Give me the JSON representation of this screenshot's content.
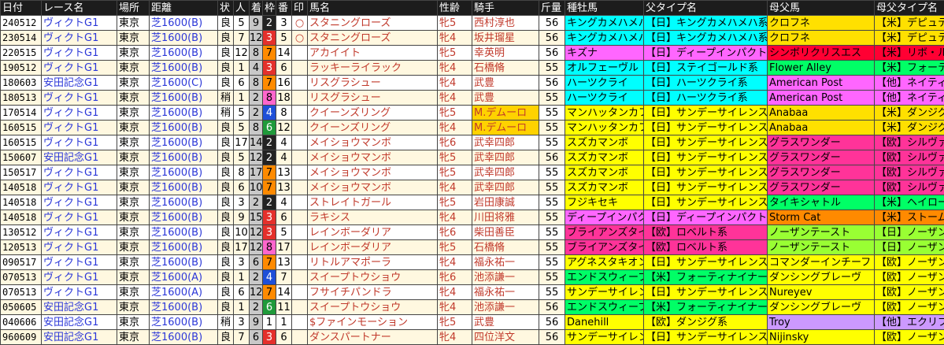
{
  "headers": [
    "日付",
    "レース名",
    "場所",
    "距離",
    "状",
    "人",
    "着",
    "枠",
    "番",
    "印",
    "馬名",
    "性齢",
    "騎手",
    "斤量",
    "種牡馬",
    "父タイプ名",
    "母父馬",
    "母父タイプ名"
  ],
  "colors": {
    "gate": {
      "1": "#ffffff",
      "2": "#222222",
      "3": "#e4302b",
      "4": "#1e4fd8",
      "5": "#f2e600",
      "6": "#1f9a3a",
      "7": "#ff8a00",
      "8": "#ff66cc"
    },
    "row_alt": "#fff8e0",
    "jockey_highlight": "#ffd200"
  },
  "rows": [
    {
      "date": "240512",
      "race": "ヴィクトG1",
      "place": "東京",
      "dist": "芝1600(B)",
      "cond": "良",
      "pop": "5",
      "pos": "9",
      "gate": "2",
      "num": "3",
      "mark": "○",
      "horse": "スタニングローズ",
      "sex": "牝5",
      "jockey": "西村淳也",
      "wt": "56",
      "sire": "キングカメハメハ",
      "sire_bg": "#00ffff",
      "stype": "【日】キングカメハメハ系",
      "stype_bg": "#00ffff",
      "dams": "クロフネ",
      "dams_bg": "#ffe000",
      "dtype": "【米】デピュティミニスター",
      "dtype_bg": "#ffe000"
    },
    {
      "date": "230514",
      "race": "ヴィクトG1",
      "place": "東京",
      "dist": "芝1600(B)",
      "cond": "良",
      "pop": "7",
      "pos": "12",
      "gate": "3",
      "num": "5",
      "mark": "○",
      "horse": "スタニングローズ",
      "sex": "牝4",
      "jockey": "坂井瑠星",
      "wt": "56",
      "sire": "キングカメハメハ",
      "sire_bg": "#00ffff",
      "stype": "【日】キングカメハメハ系",
      "stype_bg": "#00ffff",
      "dams": "クロフネ",
      "dams_bg": "#ffe000",
      "dtype": "【米】デピュティミニスター",
      "dtype_bg": "#ffe000"
    },
    {
      "date": "220515",
      "race": "ヴィクトG1",
      "place": "東京",
      "dist": "芝1600(B)",
      "cond": "良",
      "pop": "12",
      "pos": "8",
      "gate": "7",
      "num": "14",
      "mark": "",
      "horse": "アカイイト",
      "sex": "牝5",
      "jockey": "幸英明",
      "wt": "56",
      "sire": "キズナ",
      "sire_bg": "#ff66ff",
      "stype": "【日】ディープインパクト系",
      "stype_bg": "#ff66ff",
      "dams": "シンボリクリスエス",
      "dams_bg": "#ff0033",
      "dtype": "【米】リボ・ルクリスエス系",
      "dtype_bg": "#ff0033"
    },
    {
      "date": "190512",
      "race": "ヴィクトG1",
      "place": "東京",
      "dist": "芝1600(B)",
      "cond": "良",
      "pop": "1",
      "pos": "4",
      "gate": "3",
      "num": "6",
      "mark": "",
      "horse": "ラッキーライラック",
      "sex": "牝4",
      "jockey": "石橋脩",
      "wt": "55",
      "sire": "オルフェーヴル",
      "sire_bg": "#00ffff",
      "stype": "【日】ステイゴールド系",
      "stype_bg": "#00ffff",
      "dams": "Flower Alley",
      "dams_bg": "#00ff66",
      "dtype": "【米】フォーティナイナー系",
      "dtype_bg": "#00ff66"
    },
    {
      "date": "180603",
      "race": "安田記念G1",
      "place": "東京",
      "dist": "芝1600(C)",
      "cond": "良",
      "pop": "6",
      "pos": "8",
      "gate": "7",
      "num": "16",
      "mark": "",
      "horse": "リスグラシュー",
      "sex": "牝4",
      "jockey": "武豊",
      "wt": "56",
      "sire": "ハーツクライ",
      "sire_bg": "#00ffff",
      "stype": "【日】ハーツクライ系",
      "stype_bg": "#00ffff",
      "dams": "American Post",
      "dams_bg": "#ff66ff",
      "dtype": "【他】ネイティヴダンサー系",
      "dtype_bg": "#ff66ff"
    },
    {
      "date": "180513",
      "race": "ヴィクトG1",
      "place": "東京",
      "dist": "芝1600(B)",
      "cond": "稍",
      "pop": "1",
      "pos": "2",
      "gate": "8",
      "num": "18",
      "mark": "",
      "horse": "リスグラシュー",
      "sex": "牝4",
      "jockey": "武豊",
      "wt": "55",
      "sire": "ハーツクライ",
      "sire_bg": "#00ffff",
      "stype": "【日】ハーツクライ系",
      "stype_bg": "#00ffff",
      "dams": "American Post",
      "dams_bg": "#ff66ff",
      "dtype": "【他】ネイティヴダンサー系",
      "dtype_bg": "#ff66ff"
    },
    {
      "date": "170514",
      "race": "ヴィクトG1",
      "place": "東京",
      "dist": "芝1600(B)",
      "cond": "稍",
      "pop": "5",
      "pos": "2",
      "gate": "4",
      "num": "8",
      "mark": "",
      "horse": "クイーンズリング",
      "sex": "牝5",
      "jockey": "M.デムーロ",
      "wt": "55",
      "sire": "マンハッタンカフェ",
      "sire_bg": "#ffff00",
      "stype": "【日】サンデーサイレンス系",
      "stype_bg": "#ffff00",
      "dams": "Anabaa",
      "dams_bg": "#ffe000",
      "dtype": "【米】ダンジグ系",
      "dtype_bg": "#ffe000"
    },
    {
      "date": "160515",
      "race": "ヴィクトG1",
      "place": "東京",
      "dist": "芝1600(B)",
      "cond": "良",
      "pop": "5",
      "pos": "8",
      "gate": "6",
      "num": "12",
      "mark": "",
      "horse": "クイーンズリング",
      "sex": "牝4",
      "jockey": "M.デムーロ",
      "wt": "55",
      "sire": "マンハッタンカフェ",
      "sire_bg": "#ffff00",
      "stype": "【日】サンデーサイレンス系",
      "stype_bg": "#ffff00",
      "dams": "Anabaa",
      "dams_bg": "#ffe000",
      "dtype": "【米】ダンジグ系",
      "dtype_bg": "#ffe000"
    },
    {
      "date": "160515",
      "race": "ヴィクトG1",
      "place": "東京",
      "dist": "芝1600(B)",
      "cond": "良",
      "pop": "17",
      "pos": "14",
      "gate": "2",
      "num": "4",
      "mark": "",
      "horse": "メイショウマンボ",
      "sex": "牝6",
      "jockey": "武幸四郎",
      "wt": "55",
      "sire": "スズカマンボ",
      "sire_bg": "#ffff00",
      "stype": "【日】サンデーサイレンス系",
      "stype_bg": "#ffff00",
      "dams": "グラスワンダー",
      "dams_bg": "#ff3399",
      "dtype": "【欧】シルヴァーホークロ",
      "dtype_bg": "#ff3399"
    },
    {
      "date": "150607",
      "race": "安田記念G1",
      "place": "東京",
      "dist": "芝1600(B)",
      "cond": "良",
      "pop": "5",
      "pos": "12",
      "gate": "2",
      "num": "4",
      "mark": "",
      "horse": "メイショウマンボ",
      "sex": "牝5",
      "jockey": "武幸四郎",
      "wt": "56",
      "sire": "スズカマンボ",
      "sire_bg": "#ffff00",
      "stype": "【日】サンデーサイレンス系",
      "stype_bg": "#ffff00",
      "dams": "グラスワンダー",
      "dams_bg": "#ff3399",
      "dtype": "【欧】シルヴァーホークロ",
      "dtype_bg": "#ff3399"
    },
    {
      "date": "150517",
      "race": "ヴィクトG1",
      "place": "東京",
      "dist": "芝1600(B)",
      "cond": "良",
      "pop": "8",
      "pos": "17",
      "gate": "7",
      "num": "13",
      "mark": "",
      "horse": "メイショウマンボ",
      "sex": "牝5",
      "jockey": "武幸四郎",
      "wt": "55",
      "sire": "スズカマンボ",
      "sire_bg": "#ffff00",
      "stype": "【日】サンデーサイレンス系",
      "stype_bg": "#ffff00",
      "dams": "グラスワンダー",
      "dams_bg": "#ff3399",
      "dtype": "【欧】シルヴァーホークロ",
      "dtype_bg": "#ff3399"
    },
    {
      "date": "140518",
      "race": "ヴィクトG1",
      "place": "東京",
      "dist": "芝1600(B)",
      "cond": "良",
      "pop": "6",
      "pos": "10",
      "gate": "7",
      "num": "13",
      "mark": "",
      "horse": "メイショウマンボ",
      "sex": "牝4",
      "jockey": "武幸四郎",
      "wt": "55",
      "sire": "スズカマンボ",
      "sire_bg": "#ffff00",
      "stype": "【日】サンデーサイレンス系",
      "stype_bg": "#ffff00",
      "dams": "グラスワンダー",
      "dams_bg": "#ff3399",
      "dtype": "【欧】シルヴァーホークロ",
      "dtype_bg": "#ff3399"
    },
    {
      "date": "140518",
      "race": "ヴィクトG1",
      "place": "東京",
      "dist": "芝1600(B)",
      "cond": "良",
      "pop": "3",
      "pos": "2",
      "gate": "2",
      "num": "4",
      "mark": "",
      "horse": "ストレイトガール",
      "sex": "牝5",
      "jockey": "岩田康誠",
      "wt": "55",
      "sire": "フジキセキ",
      "sire_bg": "#ffff00",
      "stype": "【日】サンデーサイレンス系",
      "stype_bg": "#ffff00",
      "dams": "タイキシャトル",
      "dams_bg": "#00ff66",
      "dtype": "【米】ヘイロー系",
      "dtype_bg": "#00ff66"
    },
    {
      "date": "140518",
      "race": "ヴィクトG1",
      "place": "東京",
      "dist": "芝1600(B)",
      "cond": "良",
      "pop": "9",
      "pos": "15",
      "gate": "3",
      "num": "6",
      "mark": "",
      "horse": "ラキシス",
      "sex": "牝4",
      "jockey": "川田将雅",
      "wt": "55",
      "sire": "ディープインパクト",
      "sire_bg": "#ff66ff",
      "stype": "【日】ディープインパクト系",
      "stype_bg": "#ff66ff",
      "dams": "Storm Cat",
      "dams_bg": "#ff8a00",
      "dtype": "【米】ストームキャット系",
      "dtype_bg": "#ff8a00"
    },
    {
      "date": "130512",
      "race": "ヴィクトG1",
      "place": "東京",
      "dist": "芝1600(B)",
      "cond": "良",
      "pop": "10",
      "pos": "12",
      "gate": "3",
      "num": "5",
      "mark": "",
      "horse": "レインボーダリア",
      "sex": "牝6",
      "jockey": "柴田善臣",
      "wt": "55",
      "sire": "ブライアンズタイム",
      "sire_bg": "#ff3399",
      "stype": "【欧】ロベルト系",
      "stype_bg": "#ff3399",
      "dams": "ノーザンテースト",
      "dams_bg": "#99ff33",
      "dtype": "【日】ノーザンテースト系",
      "dtype_bg": "#99ff33"
    },
    {
      "date": "120513",
      "race": "ヴィクトG1",
      "place": "東京",
      "dist": "芝1600(B)",
      "cond": "良",
      "pop": "17",
      "pos": "12",
      "gate": "8",
      "num": "17",
      "mark": "",
      "horse": "レインボーダリア",
      "sex": "牝5",
      "jockey": "石橋脩",
      "wt": "55",
      "sire": "ブライアンズタイム",
      "sire_bg": "#ff3399",
      "stype": "【欧】ロベルト系",
      "stype_bg": "#ff3399",
      "dams": "ノーザンテースト",
      "dams_bg": "#99ff33",
      "dtype": "【日】ノーザンテースト系",
      "dtype_bg": "#99ff33"
    },
    {
      "date": "090517",
      "race": "ヴィクトG1",
      "place": "東京",
      "dist": "芝1600(B)",
      "cond": "良",
      "pop": "3",
      "pos": "6",
      "gate": "7",
      "num": "13",
      "mark": "",
      "horse": "リトルアマポーラ",
      "sex": "牝4",
      "jockey": "福永祐一",
      "wt": "55",
      "sire": "アグネスタキオン",
      "sire_bg": "#ffff00",
      "stype": "【日】サンデーサイレンス系",
      "stype_bg": "#ffff00",
      "dams": "コマンダーインチーフ",
      "dams_bg": "#ffff00",
      "dtype": "【欧】ノーザンダンサー系",
      "dtype_bg": "#ffff00"
    },
    {
      "date": "070513",
      "race": "ヴィクトG1",
      "place": "東京",
      "dist": "芝1600(A)",
      "cond": "良",
      "pop": "1",
      "pos": "2",
      "gate": "4",
      "num": "7",
      "mark": "",
      "horse": "スイープトウショウ",
      "sex": "牝6",
      "jockey": "池添謙一",
      "wt": "55",
      "sire": "エンドスウィープ",
      "sire_bg": "#00ff66",
      "stype": "【米】フォーティナイナー系",
      "stype_bg": "#00ff66",
      "dams": "ダンシングブレーヴ",
      "dams_bg": "#ffff00",
      "dtype": "【欧】ノーザンダンサー系",
      "dtype_bg": "#ffff00"
    },
    {
      "date": "070513",
      "race": "ヴィクトG1",
      "place": "東京",
      "dist": "芝1600(A)",
      "cond": "良",
      "pop": "6",
      "pos": "12",
      "gate": "7",
      "num": "14",
      "mark": "",
      "horse": "フサイチパンドラ",
      "sex": "牝4",
      "jockey": "福永祐一",
      "wt": "55",
      "sire": "サンデーサイレンス",
      "sire_bg": "#ffff00",
      "stype": "【日】サンデーサイレンス系",
      "stype_bg": "#ffff00",
      "dams": "Nureyev",
      "dams_bg": "#ffff00",
      "dtype": "【欧】ノーザンダンサー系",
      "dtype_bg": "#ffff00"
    },
    {
      "date": "050605",
      "race": "安田記念G1",
      "place": "東京",
      "dist": "芝1600(B)",
      "cond": "良",
      "pop": "1",
      "pos": "2",
      "gate": "6",
      "num": "11",
      "mark": "",
      "horse": "スイープトウショウ",
      "sex": "牝4",
      "jockey": "池添謙一",
      "wt": "56",
      "sire": "エンドスウィープ",
      "sire_bg": "#00ff66",
      "stype": "【米】フォーティナイナー系",
      "stype_bg": "#00ff66",
      "dams": "ダンシングブレーヴ",
      "dams_bg": "#ffff00",
      "dtype": "【欧】ノーザンダンサー系",
      "dtype_bg": "#ffff00"
    },
    {
      "date": "040606",
      "race": "安田記念G1",
      "place": "東京",
      "dist": "芝1600(B)",
      "cond": "稍",
      "pop": "3",
      "pos": "9",
      "gate": "1",
      "num": "1",
      "mark": "",
      "horse": "$ファインモーション",
      "sex": "牝5",
      "jockey": "武豊",
      "wt": "56",
      "sire": "Danehill",
      "sire_bg": "#ffff00",
      "stype": "【欧】ダンジグ系",
      "stype_bg": "#ffff00",
      "dams": "Troy",
      "dams_bg": "#cc99ff",
      "dtype": "【他】エクリプス系",
      "dtype_bg": "#cc99ff"
    },
    {
      "date": "960609",
      "race": "安田記念G1",
      "place": "東京",
      "dist": "芝1600(B)",
      "cond": "良",
      "pop": "7",
      "pos": "6",
      "gate": "3",
      "num": "6",
      "mark": "",
      "horse": "ダンスパートナー",
      "sex": "牝4",
      "jockey": "四位洋文",
      "wt": "56",
      "sire": "サンデーサイレンス",
      "sire_bg": "#ffff00",
      "stype": "【日】サンデーサイレンス系",
      "stype_bg": "#ffff00",
      "dams": "Nijinsky",
      "dams_bg": "#ffff00",
      "dtype": "【欧】ノーザンダンサー系",
      "dtype_bg": "#ffff00"
    }
  ]
}
